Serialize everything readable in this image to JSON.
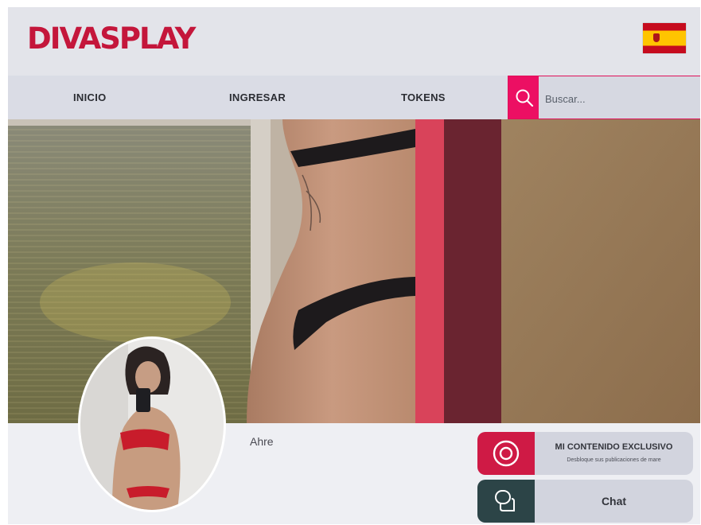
{
  "brand": {
    "logo": "DIVASPLAY",
    "flag_icon": "spain-flag-icon",
    "accent": "#c4163b"
  },
  "nav": {
    "items": [
      {
        "label": "INICIO"
      },
      {
        "label": "INGRESAR"
      },
      {
        "label": "TOKENS"
      }
    ],
    "search": {
      "placeholder": "Buscar...",
      "value": "",
      "icon": "search-icon",
      "color": "#ec0f63"
    }
  },
  "profile": {
    "username": "Ahre",
    "exclusive": {
      "title": "MI CONTENIDO EXCLUSIVO",
      "subtitle": "Desbloque sus publicaciones de mare",
      "icon": "eye-icon",
      "color": "#cf1a45"
    },
    "chat": {
      "label": "Chat",
      "icon": "chat-icon",
      "color": "#2c4447"
    }
  }
}
